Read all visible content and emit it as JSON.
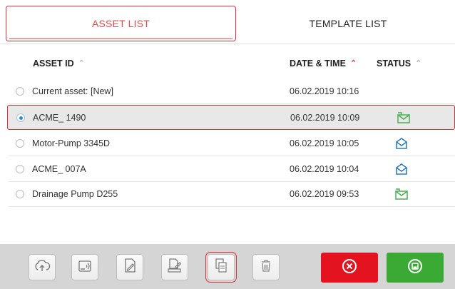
{
  "tabs": [
    {
      "label": "ASSET LIST",
      "active": true
    },
    {
      "label": "TEMPLATE LIST",
      "active": false
    }
  ],
  "columns": {
    "asset_id": "ASSET ID",
    "date_time": "DATE & TIME",
    "status": "STATUS"
  },
  "rows": [
    {
      "name": "Current asset: [New]",
      "date": "06.02.2019 10:16",
      "status": "",
      "selected": false
    },
    {
      "name": "ACME_ 1490",
      "date": "06.02.2019 10:09",
      "status": "green-envelope-icon",
      "selected": true
    },
    {
      "name": "Motor-Pump 3345D",
      "date": "06.02.2019 10:05",
      "status": "blue-envelope-icon",
      "selected": false
    },
    {
      "name": "ACME_ 007A",
      "date": "06.02.2019 10:04",
      "status": "blue-envelope-icon",
      "selected": false
    },
    {
      "name": "Drainage Pump D255",
      "date": "06.02.2019 09:53",
      "status": "green-envelope-icon",
      "selected": false
    }
  ],
  "toolbar": {
    "buttons": [
      "cloud-upload-icon",
      "rfid-tag-icon",
      "edit-document-icon",
      "print-document-icon",
      "copy-document-icon",
      "trash-icon"
    ],
    "cancel_icon": "cancel-icon",
    "save_icon": "save-icon"
  },
  "colors": {
    "accent_red": "#d6333c",
    "cancel": "#e3141f",
    "save": "#3aaa35",
    "status_green": "#4caf50",
    "status_blue": "#2a7fc4"
  }
}
